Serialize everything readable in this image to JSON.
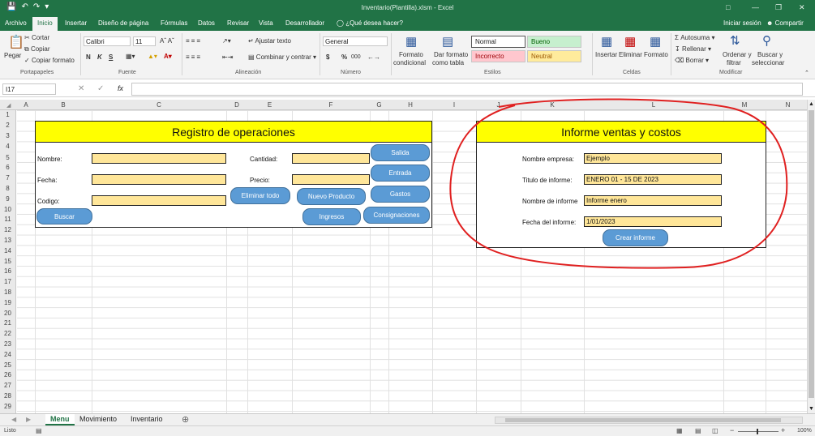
{
  "app": {
    "title": "Inventario(Plantilla).xlsm  -  Excel",
    "qat_icons": [
      "save-icon",
      "undo-icon",
      "redo-icon",
      "customize-icon"
    ]
  },
  "tabs": [
    "Archivo",
    "Inicio",
    "Insertar",
    "Diseño de página",
    "Fórmulas",
    "Datos",
    "Revisar",
    "Vista",
    "Desarrollador"
  ],
  "active_tab": "Inicio",
  "tell_me": "¿Qué desea hacer?",
  "signin": "Iniciar sesión",
  "share": "Compartir",
  "ribbon": {
    "clipboard": {
      "paste": "Pegar",
      "cut": "Cortar",
      "copy": "Copiar",
      "format_painter": "Copiar formato",
      "group": "Portapapeles"
    },
    "font": {
      "name": "Calibri",
      "size": "11",
      "group": "Fuente",
      "bold": "N",
      "italic": "K",
      "underline": "S"
    },
    "alignment": {
      "wrap": "Ajustar texto",
      "merge": "Combinar y centrar",
      "group": "Alineación"
    },
    "number": {
      "format": "General",
      "currency": "$",
      "percent": "%",
      "thousands": "000",
      "group": "Número"
    },
    "styles": {
      "conditional": "Formato",
      "conditional2": "condicional",
      "as_table": "Dar formato",
      "as_table2": "como tabla",
      "normal": "Normal",
      "good": "Bueno",
      "bad": "Incorrecto",
      "neutral": "Neutral",
      "group": "Estilos",
      "good_color": "#c6efce",
      "bad_color": "#ffc7ce",
      "neutral_color": "#ffeb9c"
    },
    "cells": {
      "insert": "Insertar",
      "delete": "Eliminar",
      "format": "Formato",
      "group": "Celdas"
    },
    "editing": {
      "autosum": "Autosuma",
      "fill": "Rellenar",
      "clear": "Borrar",
      "sort": "Ordenar y",
      "sort2": "filtrar",
      "find": "Buscar y",
      "find2": "seleccionar",
      "group": "Modificar"
    }
  },
  "formula_bar": {
    "name_box": "I17",
    "fx": "fx",
    "value": ""
  },
  "columns": [
    "A",
    "B",
    "C",
    "D",
    "E",
    "F",
    "G",
    "H",
    "I",
    "J",
    "K",
    "L",
    "M",
    "N"
  ],
  "rows": [
    "1",
    "2",
    "3",
    "4",
    "5",
    "6",
    "7",
    "8",
    "9",
    "10",
    "11",
    "12",
    "13",
    "14",
    "15",
    "16",
    "17",
    "18",
    "19",
    "20",
    "21",
    "22",
    "23",
    "24",
    "25",
    "26",
    "27",
    "28",
    "29"
  ],
  "registro": {
    "title": "Registro de operaciones",
    "nombre_label": "Nombre:",
    "fecha_label": "Fecha:",
    "codigo_label": "Codigo:",
    "cantidad_label": "Cantidad:",
    "precio_label": "Precio:",
    "buttons": {
      "buscar": "Buscar",
      "eliminar": "Eliminar todo",
      "nuevo": "Nuevo Producto",
      "ingresos": "Ingresos",
      "salida": "Salida",
      "entrada": "Entrada",
      "gastos": "Gastos",
      "consignaciones": "Consignaciones"
    }
  },
  "informe": {
    "title": "Informe ventas y costos",
    "empresa_label": "Nombre empresa:",
    "empresa_value": "Ejemplo",
    "titulo_label": "Titulo de informe:",
    "titulo_value": "ENERO 01 - 15 DE 2023",
    "nombre_label": "Nombre de informe",
    "nombre_value": "Informe enero",
    "fecha_label": "Fecha del informe:",
    "fecha_value": "1/01/2023",
    "crear": "Crear informe"
  },
  "sheets": [
    "Menu",
    "Movimiento",
    "Inventario"
  ],
  "active_sheet": "Menu",
  "status": {
    "ready": "Listo",
    "zoom": "100%"
  },
  "colors": {
    "excel_green": "#217346",
    "header_yellow": "#ffff00",
    "field_fill": "#ffe699",
    "button_blue": "#5b9bd5",
    "annotation_red": "#e02020"
  }
}
